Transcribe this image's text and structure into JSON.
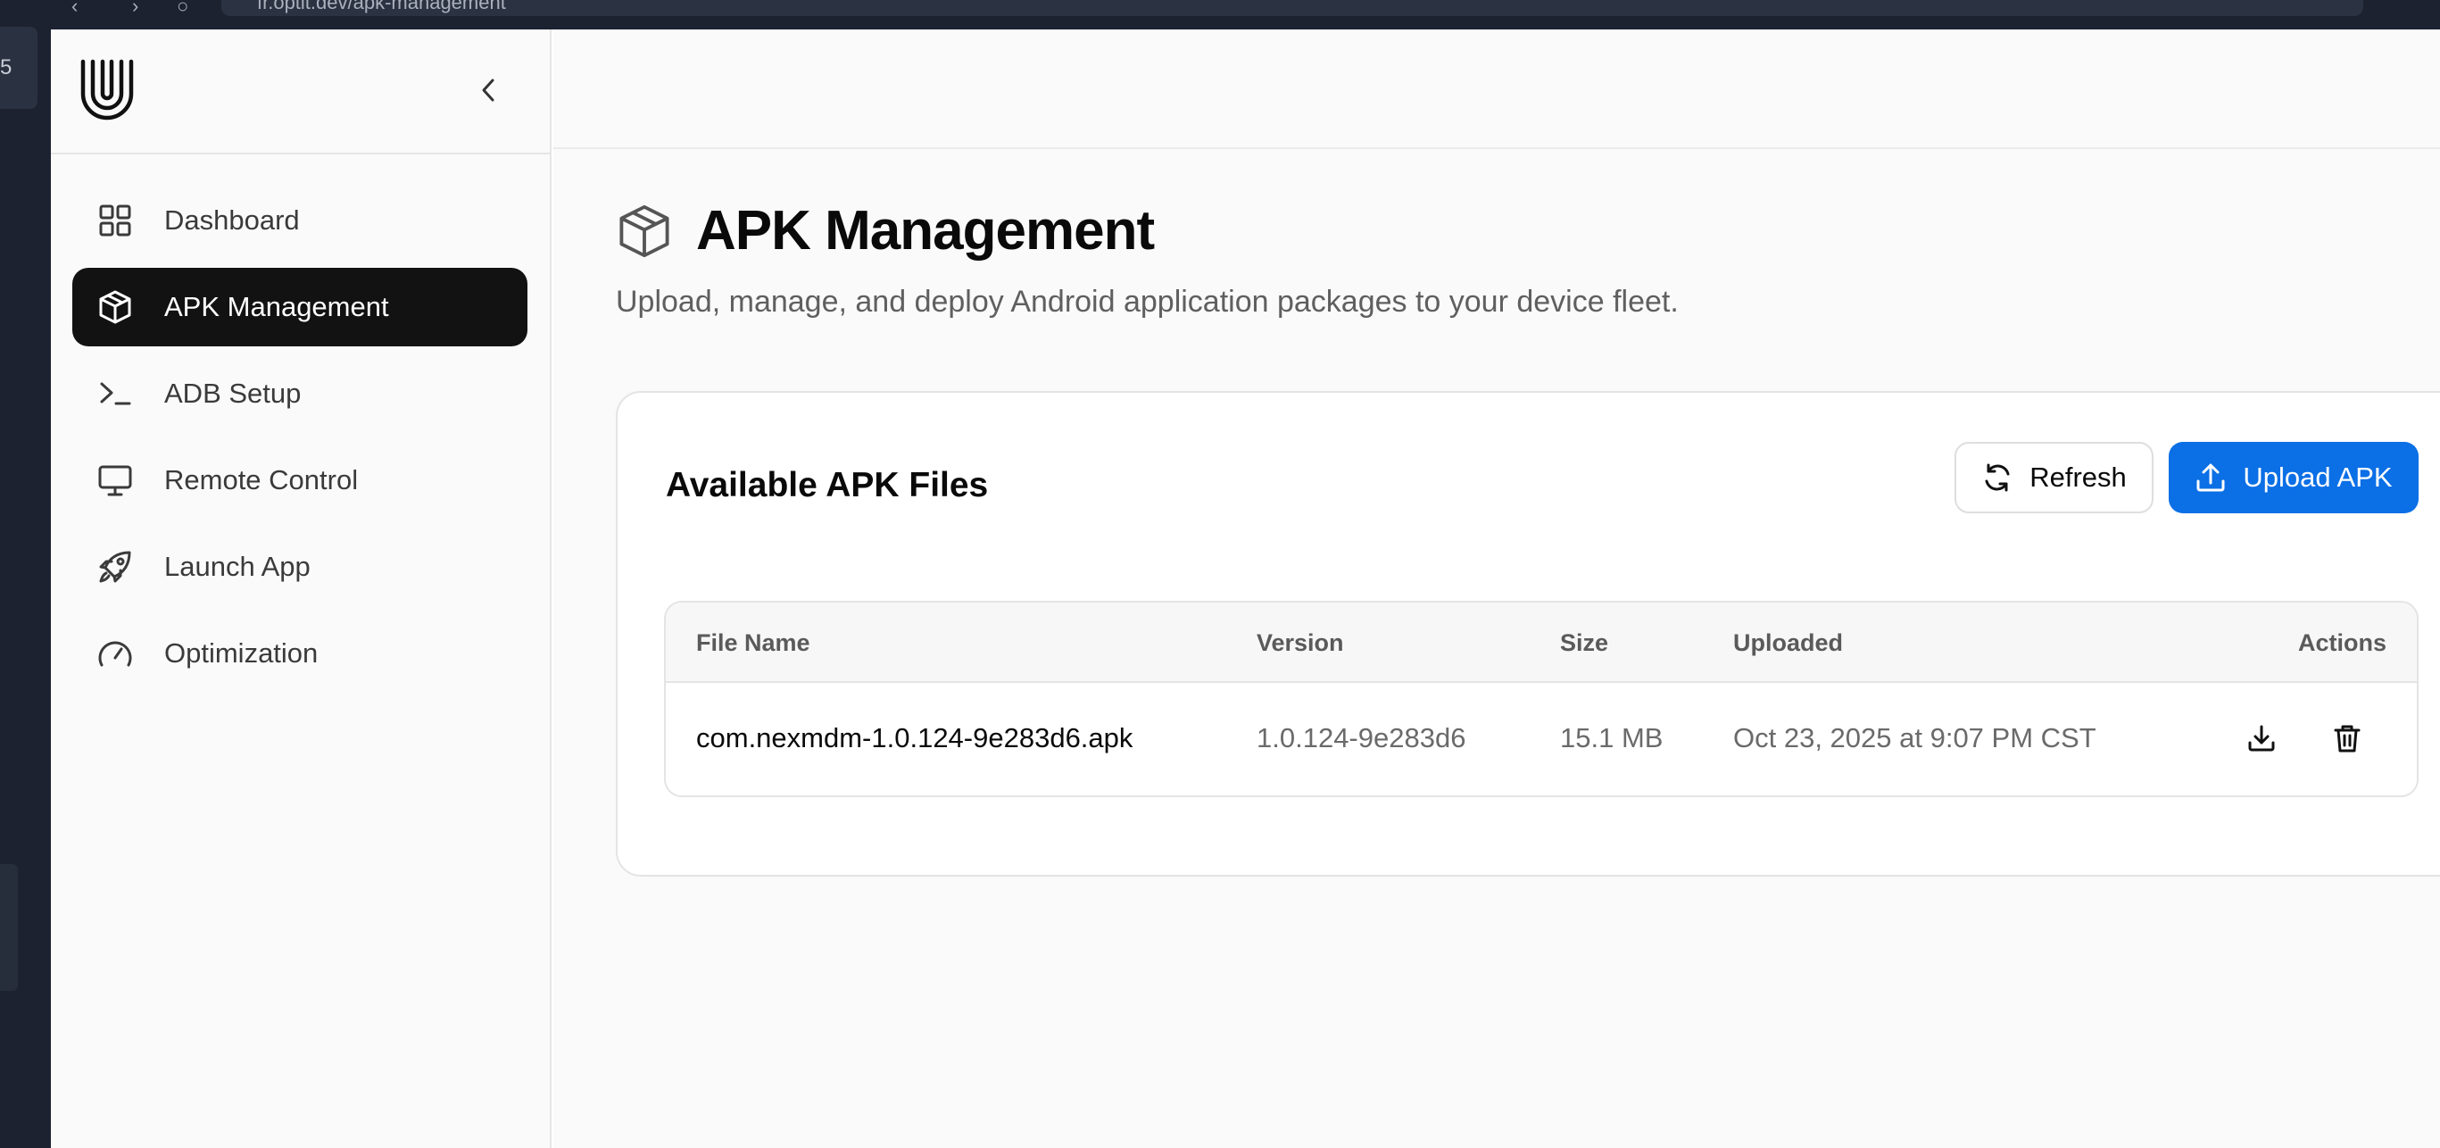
{
  "browser": {
    "tab_number": "5",
    "url_text": "fr.optit.dev/apk-management"
  },
  "sidebar": {
    "logo": "brand-logo-u",
    "items": [
      {
        "label": "Dashboard",
        "icon": "grid-icon",
        "active": false
      },
      {
        "label": "APK Management",
        "icon": "package-icon",
        "active": true
      },
      {
        "label": "ADB Setup",
        "icon": "terminal-icon",
        "active": false
      },
      {
        "label": "Remote Control",
        "icon": "monitor-icon",
        "active": false
      },
      {
        "label": "Launch App",
        "icon": "rocket-icon",
        "active": false
      },
      {
        "label": "Optimization",
        "icon": "gauge-icon",
        "active": false
      }
    ]
  },
  "page": {
    "title": "APK Management",
    "subtitle": "Upload, manage, and deploy Android application packages to your device fleet."
  },
  "card": {
    "title": "Available APK Files",
    "refresh_label": "Refresh",
    "upload_label": "Upload APK",
    "accent": "#0b6fe6"
  },
  "table": {
    "columns": [
      "File Name",
      "Version",
      "Size",
      "Uploaded",
      "Actions"
    ],
    "rows": [
      {
        "file_name": "com.nexmdm-1.0.124-9e283d6.apk",
        "version": "1.0.124-9e283d6",
        "size": "15.1 MB",
        "uploaded": "Oct 23, 2025 at 9:07 PM CST"
      }
    ]
  }
}
